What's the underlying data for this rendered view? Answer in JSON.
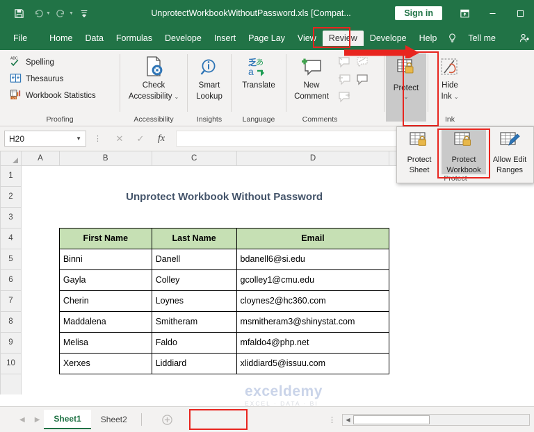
{
  "titlebar": {
    "filename": "UnprotectWorkbookWithoutPassword.xls [Compat...",
    "signin_label": "Sign in",
    "quick_access": [
      {
        "name": "save-icon",
        "glyph": "💾"
      },
      {
        "name": "undo-icon",
        "glyph": "↶"
      },
      {
        "name": "redo-icon",
        "glyph": "↷"
      },
      {
        "name": "customize-qat-icon",
        "glyph": "≡"
      }
    ],
    "window_controls": [
      {
        "name": "ribbon-display-options-icon",
        "glyph": "⬛"
      },
      {
        "name": "minimize-icon",
        "glyph": "—"
      },
      {
        "name": "maximize-icon",
        "glyph": "□"
      }
    ]
  },
  "tabs": {
    "items": [
      {
        "label": "File",
        "active": false
      },
      {
        "label": "Home",
        "active": false
      },
      {
        "label": "Data",
        "active": false
      },
      {
        "label": "Formulas",
        "active": false
      },
      {
        "label": "Develope",
        "active": false
      },
      {
        "label": "Insert",
        "active": false
      },
      {
        "label": "Page Lay",
        "active": false
      },
      {
        "label": "View",
        "active": false
      },
      {
        "label": "Review",
        "active": true
      },
      {
        "label": "Develope",
        "active": false
      },
      {
        "label": "Help",
        "active": false
      }
    ],
    "tell_me": "Tell me",
    "share": "Sh",
    "bulb_icon": "lightbulb-icon"
  },
  "ribbon": {
    "groups": [
      {
        "label": "Proofing",
        "small_items": [
          {
            "label": "Spelling",
            "icon": "spelling-abc-check-icon"
          },
          {
            "label": "Thesaurus",
            "icon": "thesaurus-book-icon"
          },
          {
            "label": "Workbook Statistics",
            "icon": "workbook-statistics-icon"
          }
        ]
      },
      {
        "label": "Accessibility",
        "button": {
          "label_line1": "Check",
          "label_line2": "Accessibility",
          "icon": "check-accessibility-icon",
          "has_caret": true
        }
      },
      {
        "label": "Insights",
        "button": {
          "label_line1": "Smart",
          "label_line2": "Lookup",
          "icon": "smart-lookup-magnifier-icon",
          "has_caret": false
        }
      },
      {
        "label": "Language",
        "button": {
          "label_line1": "Translate",
          "label_line2": "",
          "icon": "translate-icon",
          "has_caret": false
        }
      },
      {
        "label": "Comments",
        "button": {
          "label_line1": "New",
          "label_line2": "Comment",
          "icon": "new-comment-icon",
          "has_caret": false
        }
      },
      {
        "label": "Protect",
        "button": {
          "label_line1": "Protect",
          "label_line2": "",
          "icon": "protect-lock-icon",
          "has_caret": true,
          "highlighted": true,
          "pressed": true
        }
      },
      {
        "label": "Ink",
        "button": {
          "label_line1": "Hide",
          "label_line2": "Ink",
          "icon": "hide-ink-icon",
          "has_caret": true
        }
      }
    ]
  },
  "protect_dropdown": {
    "group_label": "Protect",
    "items": [
      {
        "label_line1": "Protect",
        "label_line2": "Sheet",
        "icon": "protect-sheet-icon",
        "highlighted": false
      },
      {
        "label_line1": "Protect",
        "label_line2": "Workbook",
        "icon": "protect-workbook-icon",
        "highlighted": true
      },
      {
        "label_line1": "Allow Edit",
        "label_line2": "Ranges",
        "icon": "allow-edit-ranges-icon",
        "highlighted": false
      }
    ]
  },
  "formula_bar": {
    "name_box_value": "H20",
    "cancel_icon": "cancel-x-icon",
    "enter_icon": "enter-check-icon",
    "function_icon": "insert-function-fx-icon",
    "formula_value": ""
  },
  "grid": {
    "columns": [
      "A",
      "B",
      "C",
      "D"
    ],
    "rows": [
      "1",
      "2",
      "3",
      "4",
      "5",
      "6",
      "7",
      "8",
      "9",
      "10"
    ],
    "banner_title": "Unprotect Workbook Without Password",
    "table_headers": [
      "First Name",
      "Last Name",
      "Email"
    ],
    "table_rows": [
      [
        "Binni",
        "Danell",
        "bdanell6@si.edu"
      ],
      [
        "Gayla",
        "Colley",
        "gcolley1@cmu.edu"
      ],
      [
        "Cherin",
        "Loynes",
        "cloynes2@hc360.com"
      ],
      [
        "Maddalena",
        "Smitheram",
        "msmitheram3@shinystat.com"
      ],
      [
        "Melisa",
        "Faldo",
        "mfaldo4@php.net"
      ],
      [
        "Xerxes",
        "Liddiard",
        "xliddiard5@issuu.com"
      ]
    ]
  },
  "sheetbar": {
    "prev_icon": "previous-sheet-icon",
    "next_icon": "next-sheet-icon",
    "sheets": [
      {
        "label": "Sheet1",
        "active": true
      },
      {
        "label": "Sheet2",
        "active": false
      }
    ],
    "add_sheet_icon": "add-sheet-plus-icon",
    "kebab_icon": "more-options-icon"
  },
  "watermark": {
    "main": "exceldemy",
    "sub": "EXCEL · DATA · BI"
  },
  "colors": {
    "excel_green": "#217346",
    "highlight_red": "#e8251f",
    "banner_fill": "#e2efda",
    "banner_border": "#70ad47",
    "header_fill": "#c6e0b4",
    "banner_text": "#44546a"
  }
}
